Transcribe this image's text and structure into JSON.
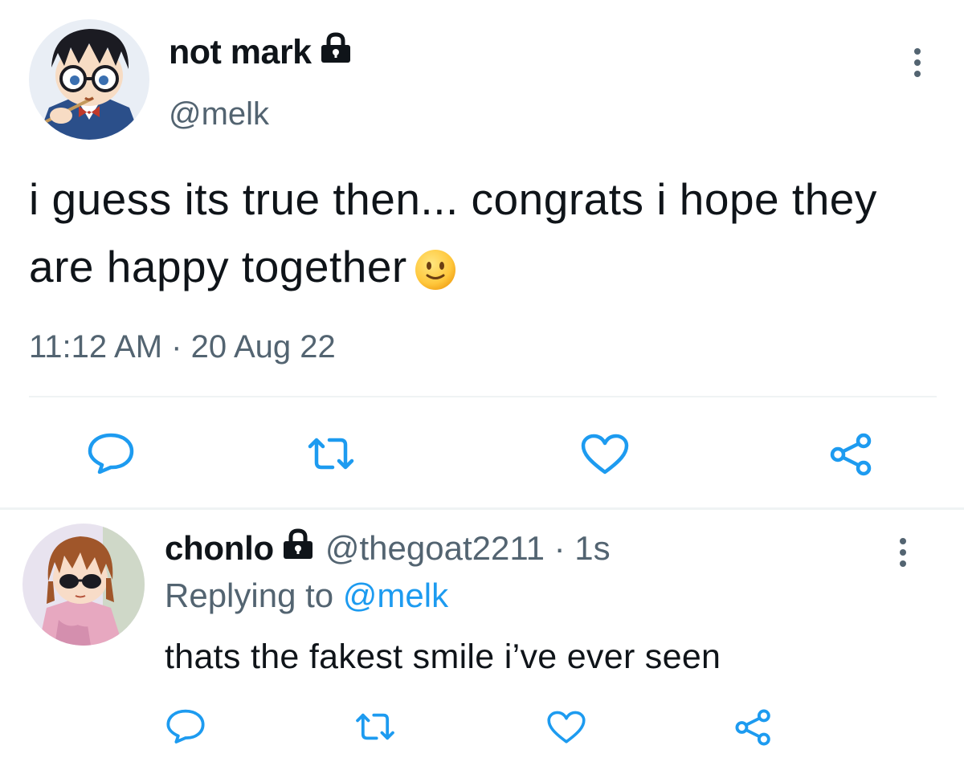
{
  "tweet": {
    "display_name": "not mark",
    "handle": "@melk",
    "text": "i guess its true then... congrats i hope they are happy together",
    "emoji": "slightly-smiling-face",
    "timestamp": "11:12 AM · 20 Aug 22",
    "protected": true
  },
  "reply": {
    "display_name": "chonlo",
    "handle": "@thegoat2211 · 1s",
    "replying_prefix": "Replying to",
    "replying_mention": "@melk",
    "text": "thats the fakest smile i’ve ever seen",
    "protected": true
  },
  "actions": [
    "reply-icon",
    "retweet-icon",
    "like-icon",
    "share-icon"
  ],
  "colors": {
    "text": "#0f1419",
    "secondary": "#536471",
    "accent": "#1d9bf0",
    "icon": "#1d9bf0",
    "divider": "#eff3f4"
  }
}
